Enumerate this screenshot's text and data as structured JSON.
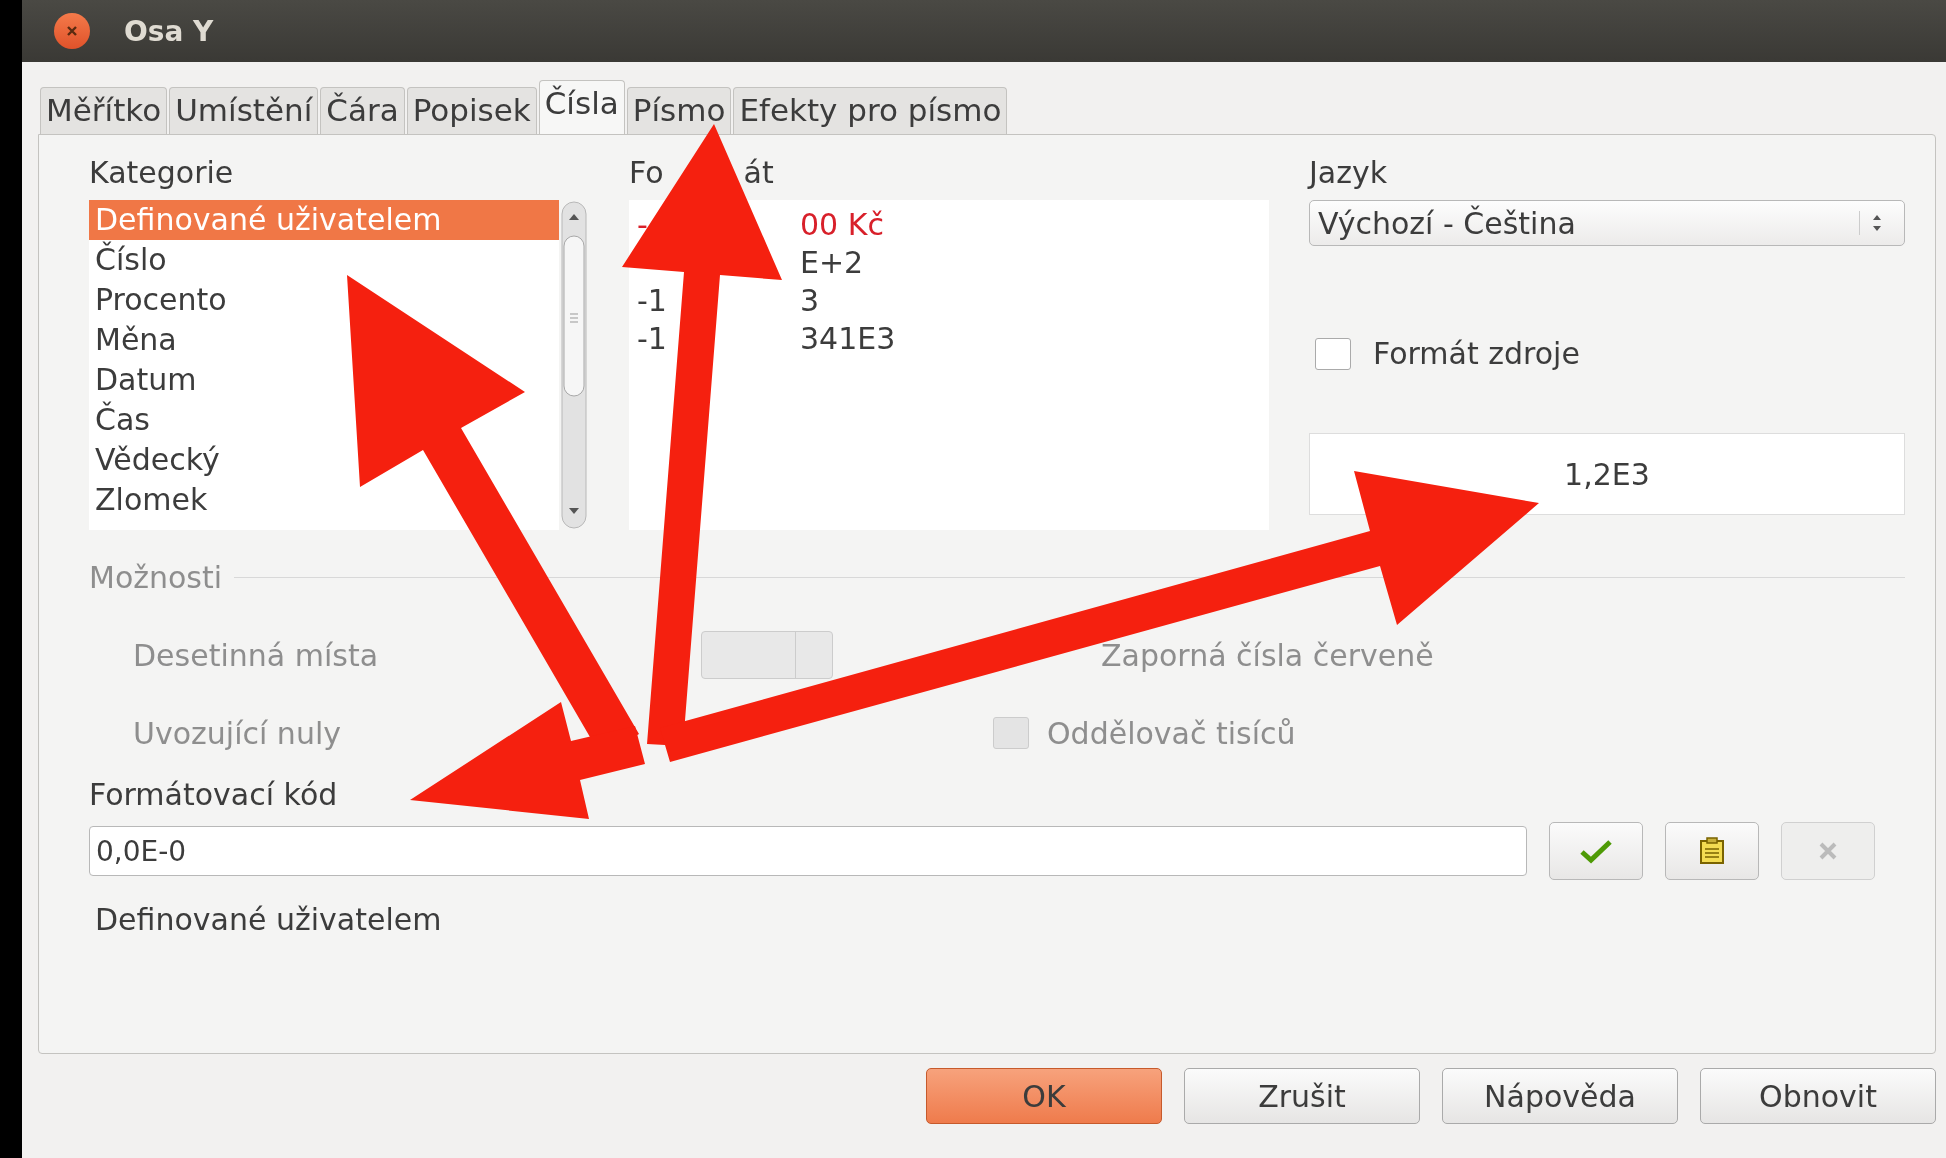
{
  "window": {
    "title": "Osa Y"
  },
  "tabs": [
    {
      "label": "Měřítko",
      "selected": false
    },
    {
      "label": "Umístění",
      "selected": false
    },
    {
      "label": "Čára",
      "selected": false
    },
    {
      "label": "Popisek",
      "selected": false
    },
    {
      "label": "Čísla",
      "selected": true
    },
    {
      "label": "Písmo",
      "selected": false
    },
    {
      "label": "Efekty pro písmo",
      "selected": false
    }
  ],
  "category": {
    "label": "Kategorie",
    "items": [
      {
        "text": "Definované uživatelem",
        "selected": true
      },
      {
        "text": "Číslo",
        "selected": false
      },
      {
        "text": "Procento",
        "selected": false
      },
      {
        "text": "Měna",
        "selected": false
      },
      {
        "text": "Datum",
        "selected": false
      },
      {
        "text": "Čas",
        "selected": false
      },
      {
        "text": "Vědecký",
        "selected": false
      },
      {
        "text": "Zlomek",
        "selected": false
      }
    ]
  },
  "format": {
    "label_parts": [
      "Fo",
      "át"
    ],
    "items": [
      {
        "lead": "-",
        "tail": "00 Kč",
        "color": "#d8202a"
      },
      {
        "tail": "E+2",
        "color": "#3c3c3c"
      },
      {
        "lead": "-1",
        "tail": "3",
        "color": "#3c3c3c"
      },
      {
        "lead": "-1",
        "tail": "341E3",
        "color": "#3c3c3c"
      }
    ]
  },
  "language": {
    "label": "Jazyk",
    "value": "Výchozí - Čeština"
  },
  "source_format": {
    "label": "Formát zdroje",
    "checked": false
  },
  "preview": "1,2E3",
  "options": {
    "label": "Možnosti",
    "decimal_places": {
      "label": "Desetinná místa",
      "disabled": true
    },
    "leading_zeros": {
      "label": "Uvozující nuly",
      "disabled": true
    },
    "negative_red": {
      "label": "Zaporná čísla červeně",
      "disabled": true
    },
    "thousands_separator": {
      "label": "Oddělovač tisíců",
      "checked": false,
      "disabled": true
    }
  },
  "format_code": {
    "label": "Formátovací kód",
    "value": "0,0E-0"
  },
  "code_buttons": [
    {
      "kind": "accept",
      "disabled": false
    },
    {
      "kind": "edit",
      "disabled": false
    },
    {
      "kind": "remove",
      "disabled": true
    }
  ],
  "description": "Definované uživatelem",
  "buttons": [
    {
      "label": "OK",
      "kind": "default"
    },
    {
      "label": "Zrušit",
      "kind": "normal"
    },
    {
      "label": "Nápověda",
      "kind": "normal"
    },
    {
      "label": "Obnovit",
      "kind": "normal"
    }
  ]
}
